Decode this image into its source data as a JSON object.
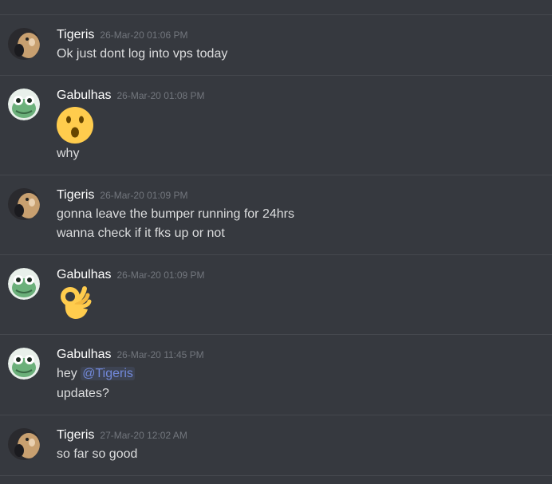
{
  "messages": [
    {
      "author": "Tigeris",
      "timestamp": "26-Mar-20 01:06 PM",
      "lines": [
        "Ok just dont log into vps today"
      ]
    },
    {
      "author": "Gabulhas",
      "timestamp": "26-Mar-20 01:08 PM",
      "emoji": "face-with-open-mouth",
      "lines": [
        "why"
      ]
    },
    {
      "author": "Tigeris",
      "timestamp": "26-Mar-20 01:09 PM",
      "lines": [
        "gonna leave the bumper running for 24hrs",
        "wanna check if it fks up or not"
      ]
    },
    {
      "author": "Gabulhas",
      "timestamp": "26-Mar-20 01:09 PM",
      "emoji": "ok-hand"
    },
    {
      "author": "Gabulhas",
      "timestamp": "26-Mar-20 11:45 PM",
      "lines": [
        "hey",
        "updates?"
      ],
      "mention": "@Tigeris"
    },
    {
      "author": "Tigeris",
      "timestamp": "27-Mar-20 12:02 AM",
      "lines": [
        "so far so good"
      ]
    }
  ],
  "colors": {
    "background": "#36393f",
    "divider": "#45484e",
    "author": "#ffffff",
    "timestamp": "#72767d",
    "text": "#dcddde",
    "mention": "#7289da"
  }
}
